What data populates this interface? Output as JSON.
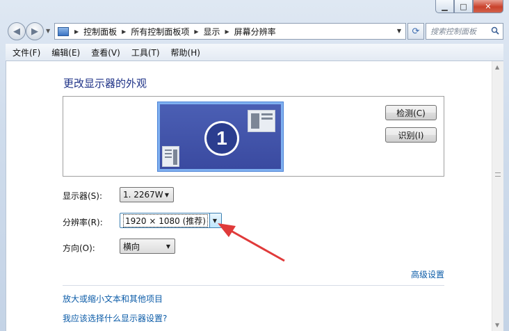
{
  "breadcrumbs": [
    "控制面板",
    "所有控制面板项",
    "显示",
    "屏幕分辨率"
  ],
  "search": {
    "placeholder": "搜索控制面板"
  },
  "menu": [
    {
      "label": "文件(F)"
    },
    {
      "label": "编辑(E)"
    },
    {
      "label": "查看(V)"
    },
    {
      "label": "工具(T)"
    },
    {
      "label": "帮助(H)"
    }
  ],
  "page": {
    "title": "更改显示器的外观",
    "monitor_number": "1",
    "detect_label": "检测(C)",
    "identify_label": "识别(I)"
  },
  "form": {
    "display": {
      "label": "显示器(S):",
      "value": "1. 2267W"
    },
    "resolution": {
      "label": "分辨率(R):",
      "value": "1920 × 1080 (推荐)"
    },
    "orientation": {
      "label": "方向(O):",
      "value": "横向"
    }
  },
  "links": {
    "advanced": "高级设置",
    "text_size": "放大或缩小文本和其他项目",
    "which_settings": "我应该选择什么显示器设置?"
  },
  "colors": {
    "title_blue": "#1e3287",
    "link_blue": "#0c5ca8",
    "annotation_arrow": "#e03a3a",
    "monitor_fill": "#3a4aa0"
  }
}
